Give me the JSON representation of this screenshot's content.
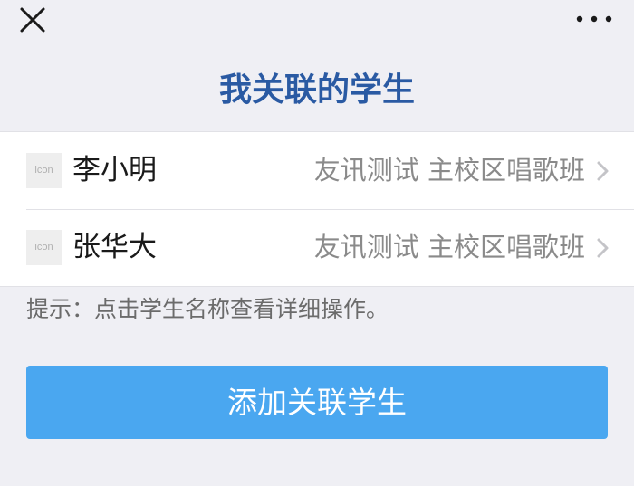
{
  "header": {
    "close_icon": "close-icon",
    "more_icon": "more-dots-icon"
  },
  "page": {
    "title": "我关联的学生"
  },
  "students": [
    {
      "avatar_text": "icon",
      "name": "李小明",
      "class_info": "友讯测试 主校区唱歌班"
    },
    {
      "avatar_text": "icon",
      "name": "张华大",
      "class_info": "友讯测试 主校区唱歌班"
    }
  ],
  "hint": {
    "text": "提示：点击学生名称查看详细操作。"
  },
  "actions": {
    "add_label": "添加关联学生"
  },
  "colors": {
    "background": "#efeff4",
    "title": "#2a5aa3",
    "button": "#4aa7f0"
  }
}
